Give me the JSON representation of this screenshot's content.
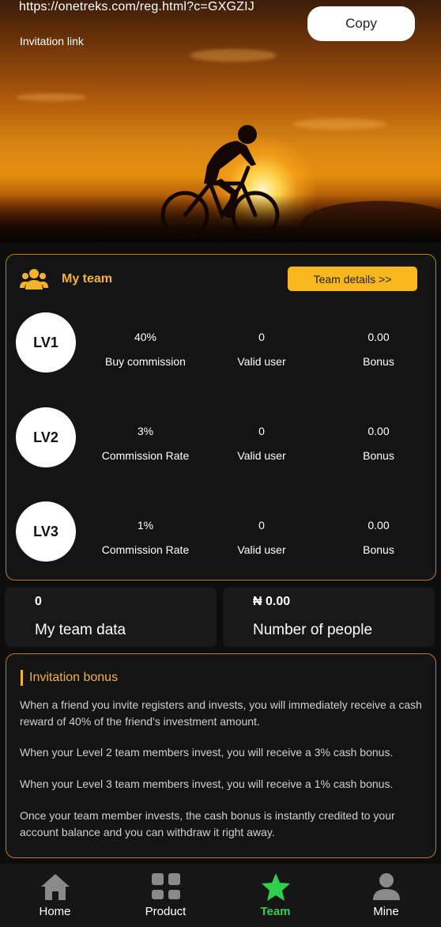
{
  "invite": {
    "url": "https://onetreks.com/reg.html?c=GXGZIJ",
    "label": "Invitation link",
    "copy_label": "Copy"
  },
  "team": {
    "title": "My team",
    "details_label": "Team details >>",
    "levels": [
      {
        "level": "LV1",
        "rate": "40%",
        "rate_label": "Buy commission",
        "valid": "0",
        "valid_label": "Valid user",
        "bonus": "0.00",
        "bonus_label": "Bonus"
      },
      {
        "level": "LV2",
        "rate": "3%",
        "rate_label": "Commission Rate",
        "valid": "0",
        "valid_label": "Valid user",
        "bonus": "0.00",
        "bonus_label": "Bonus"
      },
      {
        "level": "LV3",
        "rate": "1%",
        "rate_label": "Commission Rate",
        "valid": "0",
        "valid_label": "Valid user",
        "bonus": "0.00",
        "bonus_label": "Bonus"
      }
    ]
  },
  "summary": {
    "team_data_value": "0",
    "team_data_label": "My team data",
    "people_value": "₦ 0.00",
    "people_label": "Number of people"
  },
  "bonus": {
    "title": "Invitation bonus",
    "paragraphs": [
      "When a friend you invite registers and invests, you will immediately receive a cash reward of 40% of the friend's investment amount.",
      "When your Level 2 team members invest, you will receive a 3% cash bonus.",
      "When your Level 3 team members invest, you will receive a 1% cash bonus.",
      "Once your team member invests, the cash bonus is instantly credited to your account balance and you can withdraw it right away."
    ]
  },
  "nav": {
    "items": [
      {
        "label": "Home",
        "icon": "home-icon"
      },
      {
        "label": "Product",
        "icon": "grid-icon"
      },
      {
        "label": "Team",
        "icon": "star-icon",
        "active": true
      },
      {
        "label": "Mine",
        "icon": "user-icon"
      }
    ]
  },
  "colors": {
    "accent": "#f5b32a",
    "active_nav": "#2fcf4b",
    "panel_border": "#c27a1b"
  }
}
